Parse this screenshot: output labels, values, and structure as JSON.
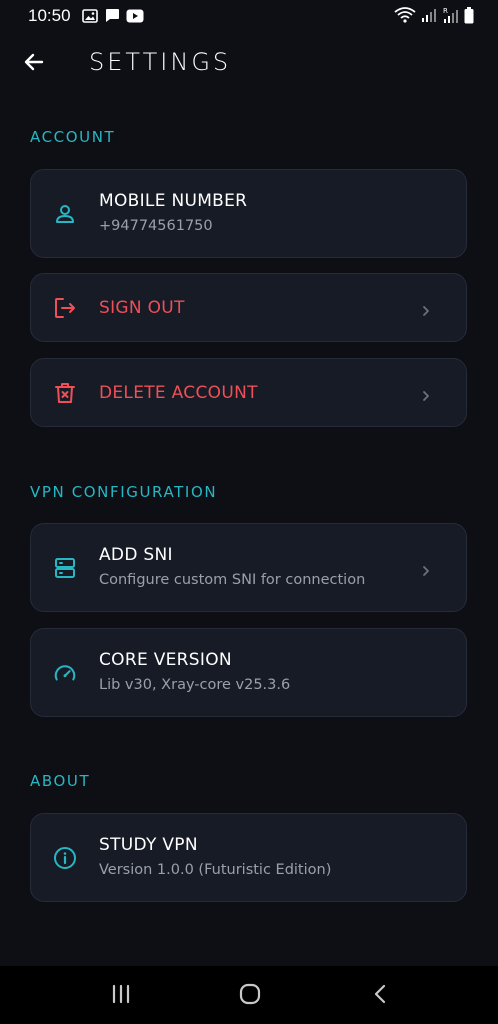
{
  "status_bar": {
    "time": "10:50",
    "left_icons": [
      "gallery-icon",
      "chat-icon",
      "youtube-icon"
    ],
    "right_icons": [
      "wifi-icon",
      "signal-icon",
      "signal-roaming-icon",
      "battery-icon"
    ]
  },
  "header": {
    "title": "SETTINGS",
    "back_icon": "arrow-left-icon"
  },
  "colors": {
    "background": "#0d0f14",
    "card": "#171b26",
    "accent": "#27b6c3",
    "danger": "#ef4f56",
    "subtitle": "#9aa0ab"
  },
  "sections": {
    "account": {
      "label": "ACCOUNT",
      "mobile": {
        "title": "MOBILE NUMBER",
        "subtitle": "+94774561750",
        "icon": "person-icon"
      },
      "sign_out": {
        "title": "SIGN OUT",
        "icon": "logout-icon"
      },
      "delete": {
        "title": "DELETE ACCOUNT",
        "icon": "trash-icon"
      }
    },
    "vpn": {
      "label": "VPN CONFIGURATION",
      "add_sni": {
        "title": "ADD SNI",
        "subtitle": "Configure custom SNI for connection",
        "icon": "server-icon"
      },
      "core_version": {
        "title": "CORE VERSION",
        "subtitle": "Lib v30, Xray-core v25.3.6",
        "icon": "speedometer-icon"
      }
    },
    "about": {
      "label": "ABOUT",
      "app": {
        "title": "STUDY VPN",
        "subtitle": "Version 1.0.0 (Futuristic Edition)",
        "icon": "info-icon"
      }
    }
  },
  "nav_bar": {
    "buttons": [
      "recents-icon",
      "home-icon",
      "back-icon"
    ]
  }
}
